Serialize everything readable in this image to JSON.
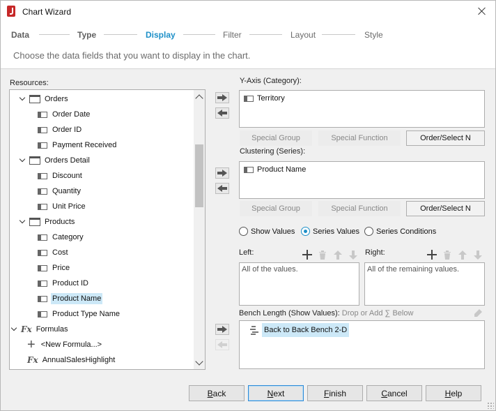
{
  "window": {
    "title": "Chart Wizard"
  },
  "steps": [
    "Data",
    "Type",
    "Display",
    "Filter",
    "Layout",
    "Style"
  ],
  "instruction": "Choose the data fields that you want to display in the chart.",
  "resources": {
    "label": "Resources:",
    "tree": [
      {
        "label": "Orders",
        "kind": "table",
        "expanded": true
      },
      {
        "label": "Order Date",
        "kind": "field"
      },
      {
        "label": "Order ID",
        "kind": "field"
      },
      {
        "label": "Payment Received",
        "kind": "field"
      },
      {
        "label": "Orders Detail",
        "kind": "table",
        "expanded": true
      },
      {
        "label": "Discount",
        "kind": "field"
      },
      {
        "label": "Quantity",
        "kind": "field"
      },
      {
        "label": "Unit Price",
        "kind": "field"
      },
      {
        "label": "Products",
        "kind": "table",
        "expanded": true
      },
      {
        "label": "Category",
        "kind": "field"
      },
      {
        "label": "Cost",
        "kind": "field"
      },
      {
        "label": "Price",
        "kind": "field"
      },
      {
        "label": "Product ID",
        "kind": "field"
      },
      {
        "label": "Product Name",
        "kind": "field",
        "selected": true
      },
      {
        "label": "Product Type Name",
        "kind": "field"
      },
      {
        "label": "Formulas",
        "kind": "folder",
        "expanded": true
      },
      {
        "label": "<New Formula...>",
        "kind": "new"
      },
      {
        "label": "AnnualSalesHighlight",
        "kind": "formula"
      }
    ]
  },
  "y_axis": {
    "label": "Y-Axis (Category):",
    "items": [
      "Territory"
    ],
    "buttons": [
      "Special Group",
      "Special Function",
      "Order/Select N"
    ]
  },
  "clustering": {
    "label": "Clustering (Series):",
    "items": [
      "Product Name"
    ],
    "buttons": [
      "Special Group",
      "Special Function",
      "Order/Select N"
    ]
  },
  "display_mode": {
    "options": [
      "Show Values",
      "Series Values",
      "Series Conditions"
    ],
    "selected": "Series Values"
  },
  "left": {
    "label": "Left:",
    "hint": "All of the values."
  },
  "right": {
    "label": "Right:",
    "hint": "All of the remaining values."
  },
  "bench": {
    "label_prefix": "Bench Length (Show Values):",
    "label_drop": "Drop or Add",
    "sigma": "∑",
    "label_below": "Below",
    "item": "Back to Back Bench 2-D"
  },
  "footer": {
    "back": {
      "pre": "",
      "mnemonic": "B",
      "post": "ack"
    },
    "next": {
      "pre": "",
      "mnemonic": "N",
      "post": "ext"
    },
    "finish": {
      "pre": "",
      "mnemonic": "F",
      "post": "inish"
    },
    "cancel": {
      "pre": "",
      "mnemonic": "C",
      "post": "ancel"
    },
    "help": {
      "pre": "",
      "mnemonic": "H",
      "post": "elp"
    }
  },
  "colors": {
    "accent": "#1e90c8",
    "selection": "#cce8f7",
    "brand": "#c62828"
  }
}
